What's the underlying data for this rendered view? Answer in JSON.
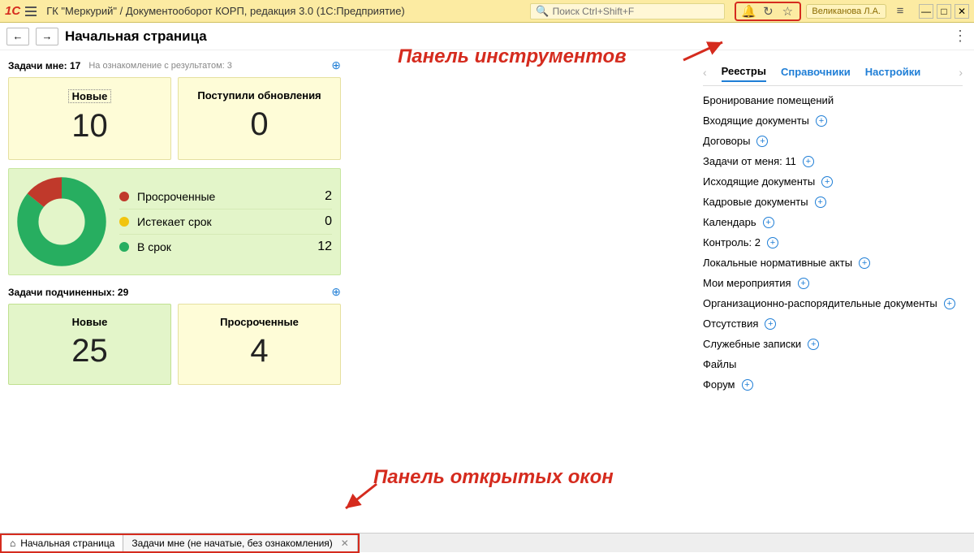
{
  "titlebar": {
    "app_title": "ГК \"Меркурий\" / Документооборот КОРП, редакция 3.0  (1С:Предприятие)",
    "search_placeholder": "Поиск Ctrl+Shift+F",
    "user": "Великанова Л.А."
  },
  "page": {
    "title": "Начальная страница"
  },
  "callouts": {
    "toolbar": "Панель инструментов",
    "windows": "Панель открытых окон"
  },
  "tasks_me": {
    "header_primary": "Задачи мне:",
    "header_count": "17",
    "header_secondary": "На ознакомление с результатом: 3",
    "tile_new_label": "Новые",
    "tile_new_value": "10",
    "tile_upd_label": "Поступили обновления",
    "tile_upd_value": "0"
  },
  "status": {
    "rows": [
      {
        "label": "Просроченные",
        "value": "2"
      },
      {
        "label": "Истекает срок",
        "value": "0"
      },
      {
        "label": "В срок",
        "value": "12"
      }
    ],
    "colors": {
      "overdue": "#c0392b",
      "due_soon": "#f1c40f",
      "ontime": "#27ae60"
    }
  },
  "tasks_sub": {
    "header_primary": "Задачи подчиненных:",
    "header_count": "29",
    "tile_new_label": "Новые",
    "tile_new_value": "25",
    "tile_over_label": "Просроченные",
    "tile_over_value": "4"
  },
  "tabs": {
    "t1": "Реестры",
    "t2": "Справочники",
    "t3": "Настройки"
  },
  "registry": [
    {
      "label": "Бронирование помещений",
      "plus": false
    },
    {
      "label": "Входящие документы",
      "plus": true
    },
    {
      "label": "Договоры",
      "plus": true
    },
    {
      "label": "Задачи от меня: 11",
      "plus": true
    },
    {
      "label": "Исходящие документы",
      "plus": true
    },
    {
      "label": "Кадровые документы",
      "plus": true
    },
    {
      "label": "Календарь",
      "plus": true
    },
    {
      "label": "Контроль: 2",
      "plus": true
    },
    {
      "label": "Локальные нормативные акты",
      "plus": true
    },
    {
      "label": "Мои мероприятия",
      "plus": true
    },
    {
      "label": "Организационно-распорядительные документы",
      "plus": true
    },
    {
      "label": "Отсутствия",
      "plus": true
    },
    {
      "label": "Служебные записки",
      "plus": true
    },
    {
      "label": "Файлы",
      "plus": false
    },
    {
      "label": "Форум",
      "plus": true
    }
  ],
  "windows": {
    "tab1": "Начальная страница",
    "tab2": "Задачи мне (не начатые, без ознакомления)"
  },
  "chart_data": {
    "type": "pie",
    "categories": [
      "Просроченные",
      "Истекает срок",
      "В срок"
    ],
    "values": [
      2,
      0,
      12
    ],
    "colors": [
      "#c0392b",
      "#f1c40f",
      "#27ae60"
    ],
    "title": ""
  }
}
